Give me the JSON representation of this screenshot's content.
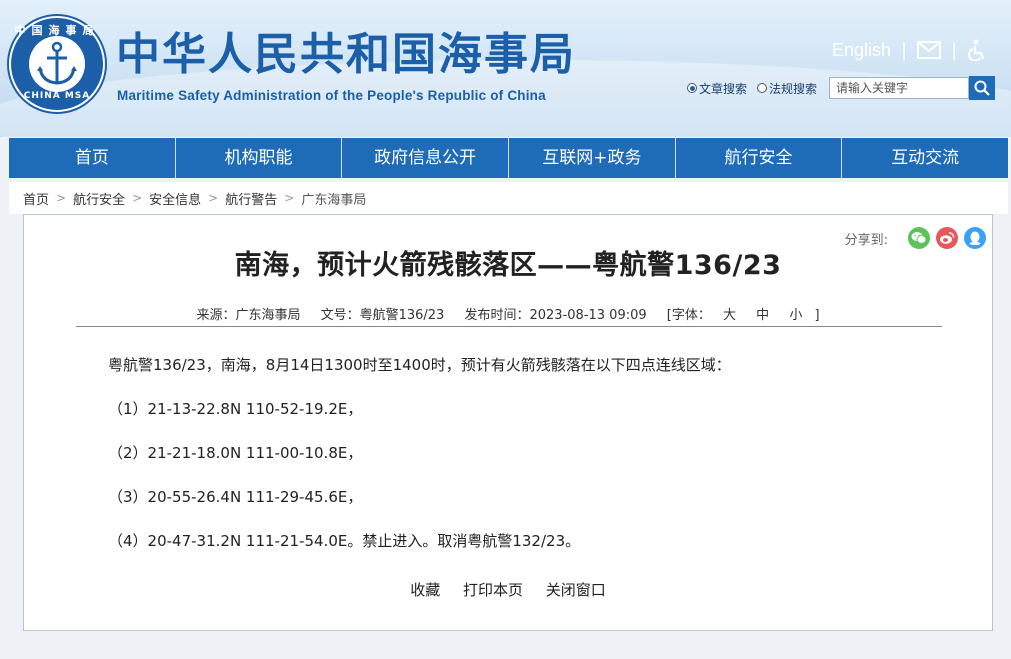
{
  "header": {
    "logo": {
      "ring_top": "中国海事局",
      "ring_bottom": "CHINA MSA",
      "icon": "anchor-icon"
    },
    "title_cn": "中华人民共和国海事局",
    "title_en": "Maritime Safety Administration of the People's Republic of China",
    "top_links": {
      "english": "English",
      "mail_icon": "mail-icon",
      "accessibility_icon": "accessibility-icon"
    },
    "search": {
      "options": [
        {
          "label": "文章搜索",
          "selected": true
        },
        {
          "label": "法规搜索",
          "selected": false
        }
      ],
      "placeholder": "请输入关键字",
      "button_icon": "search-icon"
    }
  },
  "nav": {
    "items": [
      "首页",
      "机构职能",
      "政府信息公开",
      "互联网+政务",
      "航行安全",
      "互动交流"
    ]
  },
  "breadcrumb": {
    "items": [
      "首页",
      "航行安全",
      "安全信息",
      "航行警告",
      "广东海事局"
    ],
    "separator": ">"
  },
  "article": {
    "share_label": "分享到:",
    "share_icons": [
      "wechat-icon",
      "weibo-icon",
      "qq-icon"
    ],
    "title": "南海，预计火箭残骸落区——粤航警136/23",
    "meta": {
      "source": "来源：广东海事局",
      "doc_no": "文号：粤航警136/23",
      "publish_time": "发布时间：2023-08-13 09:09",
      "font_label": "[字体：",
      "font_large": "大",
      "font_medium": "中",
      "font_small": "小",
      "font_close": "]"
    },
    "paragraphs": [
      "粤航警136/23，南海，8月14日1300时至1400时，预计有火箭残骸落在以下四点连线区域：",
      "（1）21-13-22.8N 110-52-19.2E，",
      "（2）21-21-18.0N 111-00-10.8E，",
      "（3）20-55-26.4N 111-29-45.6E，",
      "（4）20-47-31.2N 111-21-54.0E。禁止进入。取消粤航警132/23。"
    ],
    "bottom_links": [
      "收藏",
      "打印本页",
      "关闭窗口"
    ]
  },
  "colors": {
    "brand_blue": "#1a5fa8",
    "nav_blue": "#1e6bb8",
    "wechat_green": "#5cc35a",
    "weibo_red": "#e8585a",
    "qq_blue": "#3aa2f2"
  }
}
